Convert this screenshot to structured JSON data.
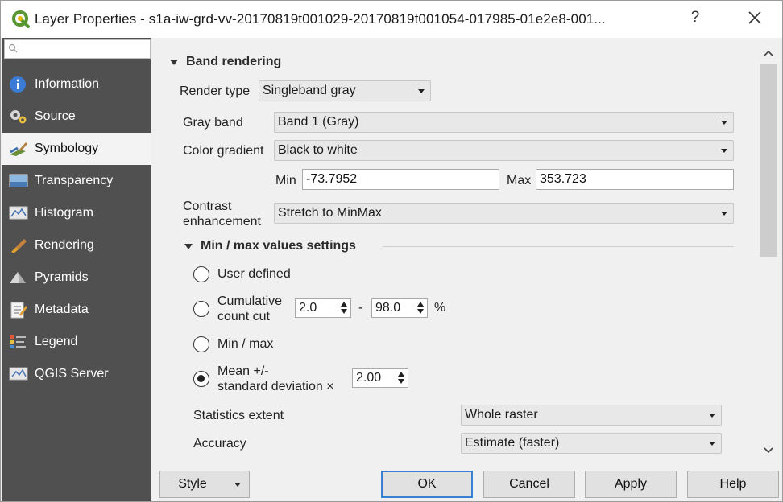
{
  "window": {
    "title": "Layer Properties - s1a-iw-grd-vv-20170819t001029-20170819t001054-017985-01e2e8-001...",
    "help_label": "?"
  },
  "search": {
    "placeholder": ""
  },
  "sidebar": {
    "items": [
      {
        "label": "Information",
        "icon": "information-icon"
      },
      {
        "label": "Source",
        "icon": "source-icon"
      },
      {
        "label": "Symbology",
        "icon": "symbology-icon",
        "active": true
      },
      {
        "label": "Transparency",
        "icon": "transparency-icon"
      },
      {
        "label": "Histogram",
        "icon": "histogram-icon"
      },
      {
        "label": "Rendering",
        "icon": "rendering-icon"
      },
      {
        "label": "Pyramids",
        "icon": "pyramids-icon"
      },
      {
        "label": "Metadata",
        "icon": "metadata-icon"
      },
      {
        "label": "Legend",
        "icon": "legend-icon"
      },
      {
        "label": "QGIS Server",
        "icon": "qgis-server-icon"
      }
    ]
  },
  "band_rendering": {
    "section_title": "Band rendering",
    "render_type_label": "Render type",
    "render_type_value": "Singleband gray",
    "gray_band_label": "Gray band",
    "gray_band_value": "Band 1 (Gray)",
    "color_gradient_label": "Color gradient",
    "color_gradient_value": "Black to white",
    "min_label": "Min",
    "min_value": "-73.7952",
    "max_label": "Max",
    "max_value": "353.723",
    "contrast_label_line1": "Contrast",
    "contrast_label_line2": "enhancement",
    "contrast_value": "Stretch to MinMax"
  },
  "minmax": {
    "section_title": "Min / max values settings",
    "user_defined_label": "User defined",
    "cumulative_label_line1": "Cumulative",
    "cumulative_label_line2": "count cut",
    "cumulative_low": "2.0",
    "cumulative_dash": "-",
    "cumulative_high": "98.0",
    "percent_label": "%",
    "minmax_label": "Min / max",
    "mean_label_line1": "Mean +/-",
    "mean_label_line2": "standard deviation ×",
    "mean_value": "2.00",
    "selected_option": "Mean +/- standard deviation",
    "statistics_extent_label": "Statistics extent",
    "statistics_extent_value": "Whole raster",
    "accuracy_label": "Accuracy",
    "accuracy_value": "Estimate (faster)"
  },
  "buttons": {
    "style": "Style",
    "ok": "OK",
    "cancel": "Cancel",
    "apply": "Apply",
    "help": "Help"
  },
  "colors": {
    "sidebar_bg": "#505050",
    "default_button_border": "#3b7fd1",
    "qgis_green": "#589632"
  }
}
